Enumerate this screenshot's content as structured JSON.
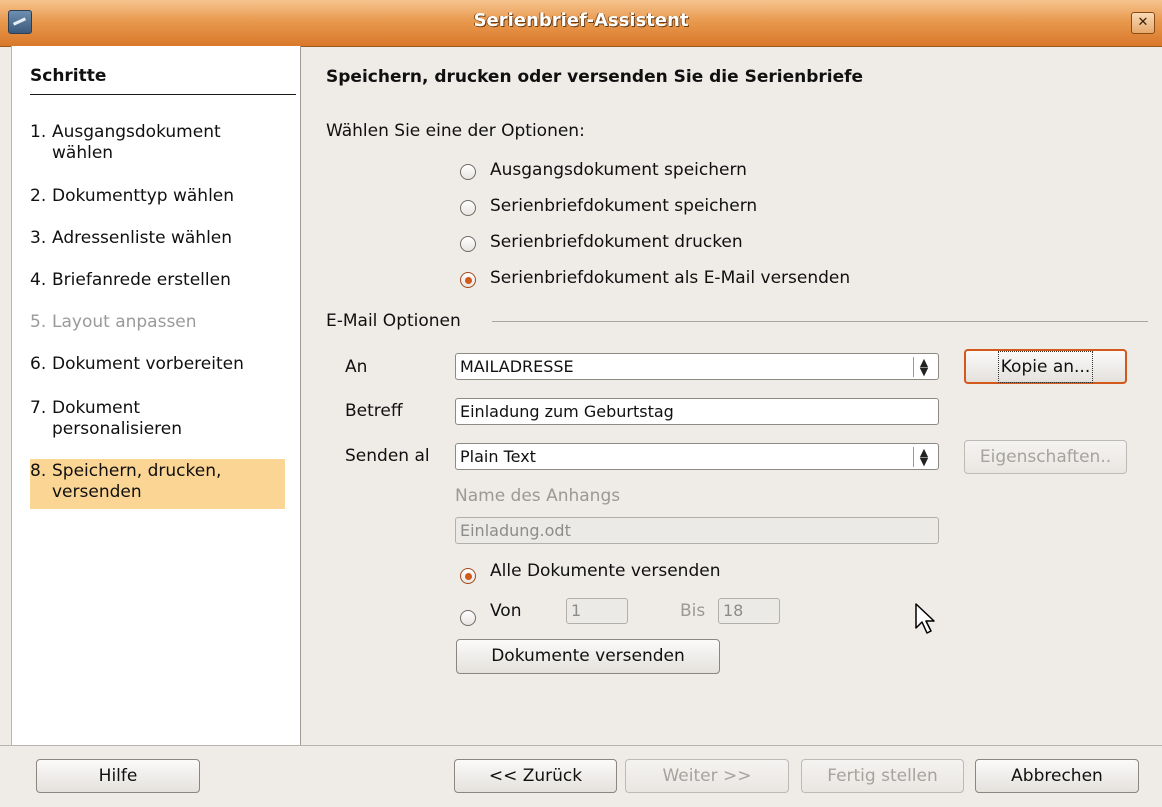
{
  "window": {
    "title": "Serienbrief-Assistent",
    "close_glyph": "✕"
  },
  "sidebar": {
    "heading": "Schritte",
    "steps": [
      {
        "num": "1.",
        "label": "Ausgangsdokument wählen",
        "state": "normal"
      },
      {
        "num": "2.",
        "label": "Dokumenttyp wählen",
        "state": "normal"
      },
      {
        "num": "3.",
        "label": "Adressenliste wählen",
        "state": "normal"
      },
      {
        "num": "4.",
        "label": "Briefanrede erstellen",
        "state": "normal"
      },
      {
        "num": "5.",
        "label": "Layout anpassen",
        "state": "disabled"
      },
      {
        "num": "6.",
        "label": "Dokument vorbereiten",
        "state": "normal"
      },
      {
        "num": "7.",
        "label": "Dokument personalisieren",
        "state": "normal"
      },
      {
        "num": "8.",
        "label": "Speichern, drucken, versenden",
        "state": "active"
      }
    ]
  },
  "main": {
    "title": "Speichern, drucken oder versenden Sie die Serienbriefe",
    "choose_label": "Wählen Sie eine der Optionen:",
    "options": [
      {
        "label": "Ausgangsdokument speichern",
        "checked": false
      },
      {
        "label": "Serienbriefdokument speichern",
        "checked": false
      },
      {
        "label": "Serienbriefdokument drucken",
        "checked": false
      },
      {
        "label": "Serienbriefdokument als E-Mail versenden",
        "checked": true
      }
    ],
    "email_group": {
      "title": "E-Mail Optionen",
      "to_label": "An",
      "to_value": "MAILADRESSE",
      "copy_button": "Kopie an...",
      "subject_label": "Betreff",
      "subject_value": "Einladung zum Geburtstag",
      "send_as_label": "Senden al",
      "send_as_value": "Plain Text",
      "properties_button": "Eigenschaften..",
      "attachment_label": "Name des Anhangs",
      "attachment_value": "Einladung.odt",
      "send_all_label": "Alle Dokumente versenden",
      "send_all_checked": true,
      "from_label": "Von",
      "from_value": "1",
      "to_range_label": "Bis",
      "to_range_value": "18",
      "send_button": "Dokumente versenden"
    }
  },
  "footer": {
    "help": "Hilfe",
    "back": "<< Zurück",
    "next": "Weiter >>",
    "finish": "Fertig stellen",
    "cancel": "Abbrechen"
  },
  "colors": {
    "titlebar": "#e89a4f",
    "active_step": "#fad593",
    "radio_dot": "#d2581b"
  }
}
